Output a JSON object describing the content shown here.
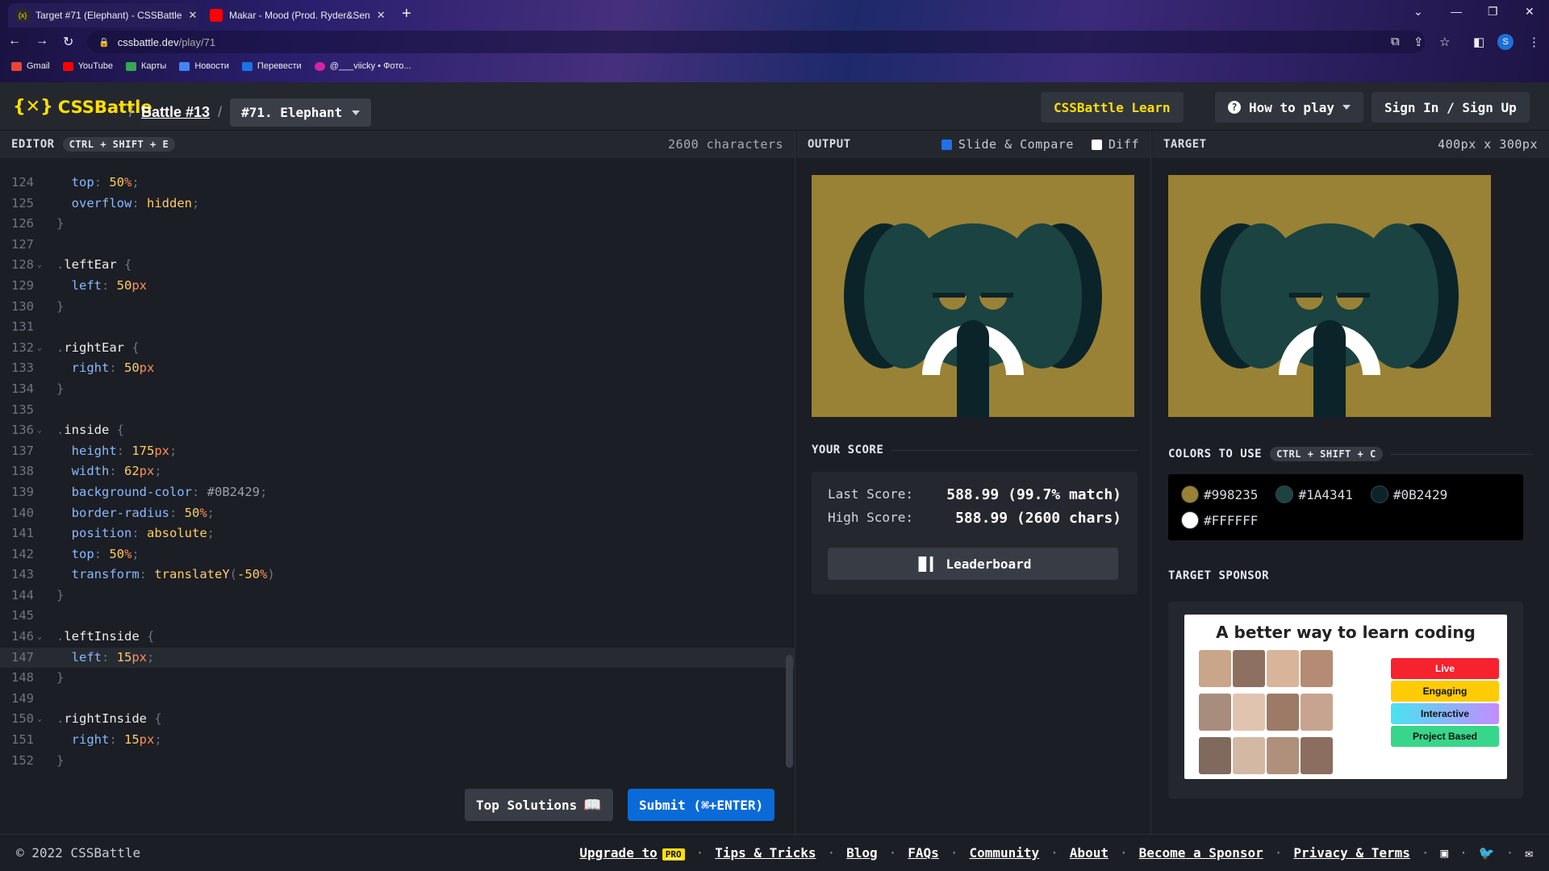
{
  "browser": {
    "tabs": [
      {
        "title": "Target #71 (Elephant) - CSSBattle",
        "active": true
      },
      {
        "title": "Makar - Mood (Prod. Ryder&Sen",
        "active": false
      }
    ],
    "url_host": "cssbattle.dev",
    "url_path": "/play/71",
    "avatar_letter": "S",
    "bookmarks": [
      "Gmail",
      "YouTube",
      "Карты",
      "Новости",
      "Перевести",
      "@___viicky • Фото..."
    ]
  },
  "header": {
    "logo": "CSSBattle",
    "battle": "Battle #13",
    "target": "#71. Elephant",
    "learn": "CSSBattle Learn",
    "howto": "How to play",
    "signin": "Sign In / Sign Up"
  },
  "editor": {
    "title": "EDITOR",
    "shortcut": "CTRL + SHIFT + E",
    "chars": "2600 characters",
    "top_solutions": "Top Solutions",
    "submit": "Submit (⌘+ENTER)",
    "lines": [
      {
        "n": "124",
        "t": [
          [
            "  top",
            "prop"
          ],
          [
            ": ",
            "br"
          ],
          [
            "50",
            "num"
          ],
          [
            "%",
            "unit"
          ],
          [
            ";",
            "br"
          ]
        ]
      },
      {
        "n": "125",
        "t": [
          [
            "  overflow",
            "prop"
          ],
          [
            ": ",
            "br"
          ],
          [
            "hidden",
            "val"
          ],
          [
            ";",
            "br"
          ]
        ]
      },
      {
        "n": "126",
        "t": [
          [
            "}",
            "br"
          ]
        ]
      },
      {
        "n": "127",
        "t": []
      },
      {
        "n": "128",
        "f": true,
        "t": [
          [
            ".",
            "br"
          ],
          [
            "leftEar",
            "sel"
          ],
          [
            " {",
            "br"
          ]
        ]
      },
      {
        "n": "129",
        "t": [
          [
            "  left",
            "prop"
          ],
          [
            ": ",
            "br"
          ],
          [
            "50",
            "num"
          ],
          [
            "px",
            "unit"
          ]
        ]
      },
      {
        "n": "130",
        "t": [
          [
            "}",
            "br"
          ]
        ]
      },
      {
        "n": "131",
        "t": []
      },
      {
        "n": "132",
        "f": true,
        "t": [
          [
            ".",
            "br"
          ],
          [
            "rightEar",
            "sel"
          ],
          [
            " {",
            "br"
          ]
        ]
      },
      {
        "n": "133",
        "t": [
          [
            "  right",
            "prop"
          ],
          [
            ": ",
            "br"
          ],
          [
            "50",
            "num"
          ],
          [
            "px",
            "unit"
          ]
        ]
      },
      {
        "n": "134",
        "t": [
          [
            "}",
            "br"
          ]
        ]
      },
      {
        "n": "135",
        "t": []
      },
      {
        "n": "136",
        "f": true,
        "t": [
          [
            ".",
            "br"
          ],
          [
            "inside",
            "sel"
          ],
          [
            " {",
            "br"
          ]
        ]
      },
      {
        "n": "137",
        "t": [
          [
            "  height",
            "prop"
          ],
          [
            ": ",
            "br"
          ],
          [
            "175",
            "num"
          ],
          [
            "px",
            "unit"
          ],
          [
            ";",
            "br"
          ]
        ]
      },
      {
        "n": "138",
        "t": [
          [
            "  width",
            "prop"
          ],
          [
            ": ",
            "br"
          ],
          [
            "62",
            "num"
          ],
          [
            "px",
            "unit"
          ],
          [
            ";",
            "br"
          ]
        ]
      },
      {
        "n": "139",
        "t": [
          [
            "  background-color",
            "prop"
          ],
          [
            ": ",
            "br"
          ],
          [
            "#0B2429",
            "hex"
          ],
          [
            ";",
            "br"
          ]
        ]
      },
      {
        "n": "140",
        "t": [
          [
            "  border-radius",
            "prop"
          ],
          [
            ": ",
            "br"
          ],
          [
            "50",
            "num"
          ],
          [
            "%",
            "unit"
          ],
          [
            ";",
            "br"
          ]
        ]
      },
      {
        "n": "141",
        "t": [
          [
            "  position",
            "prop"
          ],
          [
            ": ",
            "br"
          ],
          [
            "absolute",
            "val"
          ],
          [
            ";",
            "br"
          ]
        ]
      },
      {
        "n": "142",
        "t": [
          [
            "  top",
            "prop"
          ],
          [
            ": ",
            "br"
          ],
          [
            "50",
            "num"
          ],
          [
            "%",
            "unit"
          ],
          [
            ";",
            "br"
          ]
        ]
      },
      {
        "n": "143",
        "t": [
          [
            "  transform",
            "prop"
          ],
          [
            ": ",
            "br"
          ],
          [
            "translateY",
            "val"
          ],
          [
            "(",
            "br"
          ],
          [
            "-50",
            "num"
          ],
          [
            "%",
            "unit"
          ],
          [
            ")",
            "br"
          ]
        ]
      },
      {
        "n": "144",
        "t": [
          [
            "}",
            "br"
          ]
        ]
      },
      {
        "n": "145",
        "t": []
      },
      {
        "n": "146",
        "f": true,
        "t": [
          [
            ".",
            "br"
          ],
          [
            "leftInside",
            "sel"
          ],
          [
            " {",
            "br"
          ]
        ]
      },
      {
        "n": "147",
        "hl": true,
        "t": [
          [
            "  left",
            "prop"
          ],
          [
            ": ",
            "br"
          ],
          [
            "15",
            "num"
          ],
          [
            "px",
            "unit"
          ],
          [
            ";",
            "br"
          ]
        ]
      },
      {
        "n": "148",
        "t": [
          [
            "}",
            "br"
          ]
        ]
      },
      {
        "n": "149",
        "t": []
      },
      {
        "n": "150",
        "f": true,
        "t": [
          [
            ".",
            "br"
          ],
          [
            "rightInside",
            "sel"
          ],
          [
            " {",
            "br"
          ]
        ]
      },
      {
        "n": "151",
        "t": [
          [
            "  right",
            "prop"
          ],
          [
            ": ",
            "br"
          ],
          [
            "15",
            "num"
          ],
          [
            "px",
            "unit"
          ],
          [
            ";",
            "br"
          ]
        ]
      },
      {
        "n": "152",
        "t": [
          [
            "}",
            "br"
          ]
        ]
      }
    ]
  },
  "output": {
    "title": "OUTPUT",
    "slide": "Slide & Compare",
    "slide_checked": true,
    "diff": "Diff",
    "diff_checked": false
  },
  "target": {
    "title": "TARGET",
    "size": "400px x 300px"
  },
  "score": {
    "title": "YOUR SCORE",
    "last_label": "Last Score:",
    "last": "588.99 (99.7% match)",
    "high_label": "High Score:",
    "high": "588.99 (2600 chars)",
    "leaderboard": "Leaderboard"
  },
  "colors": {
    "title": "COLORS TO USE",
    "shortcut": "CTRL + SHIFT + C",
    "list": [
      "#998235",
      "#1A4341",
      "#0B2429",
      "#FFFFFF"
    ]
  },
  "sponsor": {
    "title": "TARGET SPONSOR",
    "headline": "A better way to learn coding",
    "pills": [
      "Live",
      "Engaging",
      "Interactive",
      "Project Based"
    ]
  },
  "footer": {
    "copy": "© 2022 CSSBattle",
    "upgrade": "Upgrade to",
    "pro": "PRO",
    "links": [
      "Tips & Tricks",
      "Blog",
      "FAQs",
      "Community",
      "About",
      "Become a Sponsor",
      "Privacy & Terms"
    ]
  },
  "theme": {
    "accent": "#ffdf00",
    "submit": "#0a6bd8"
  }
}
